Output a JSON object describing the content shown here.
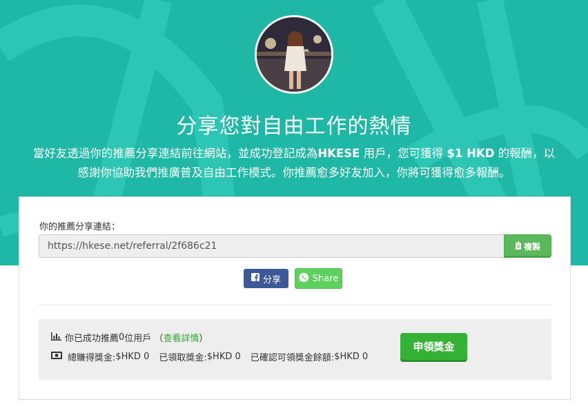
{
  "hero": {
    "title": "分享您對自由工作的熱情",
    "desc_part1": "當好友透過你的推薦分享連結前往網站，並成功登記成為",
    "desc_brand": "HKESE",
    "desc_part2": " 用戶，您可獲得 ",
    "desc_reward": "$1 HKD",
    "desc_part3": " 的報酬，以",
    "desc_line2": "感謝你協助我們推廣普及自由工作模式。你推薦愈多好友加入，你將可獲得愈多報酬。"
  },
  "referral": {
    "label": "你的推薦分享連結：",
    "url": "https://hkese.net/referral/2f686c21",
    "copy_label": "複製"
  },
  "share": {
    "facebook_label": "分享",
    "whatsapp_label": "Share"
  },
  "stats": {
    "referred_prefix": "你已成功推薦",
    "referred_count": "0",
    "referred_suffix": " 位用戶 （",
    "details_label": "查看詳情",
    "details_close": "）",
    "total_label": "總賺得獎金: ",
    "total_value": "$HKD 0",
    "received_label": "已領取獎金: ",
    "received_value": "$HKD 0",
    "balance_label": "已確認可領獎金餘額: ",
    "balance_value": "$HKD 0",
    "claim_label": "申領獎金"
  },
  "icons": {
    "copy": "clipboard-icon",
    "facebook": "facebook-icon",
    "whatsapp": "whatsapp-icon",
    "chart": "bar-chart-icon",
    "money": "money-icon"
  },
  "colors": {
    "hero_bg": "#1fb8a6",
    "success_green": "#5cb85c",
    "claim_green": "#35b135",
    "facebook_blue": "#3b5998",
    "whatsapp_green": "#5cd15c"
  }
}
